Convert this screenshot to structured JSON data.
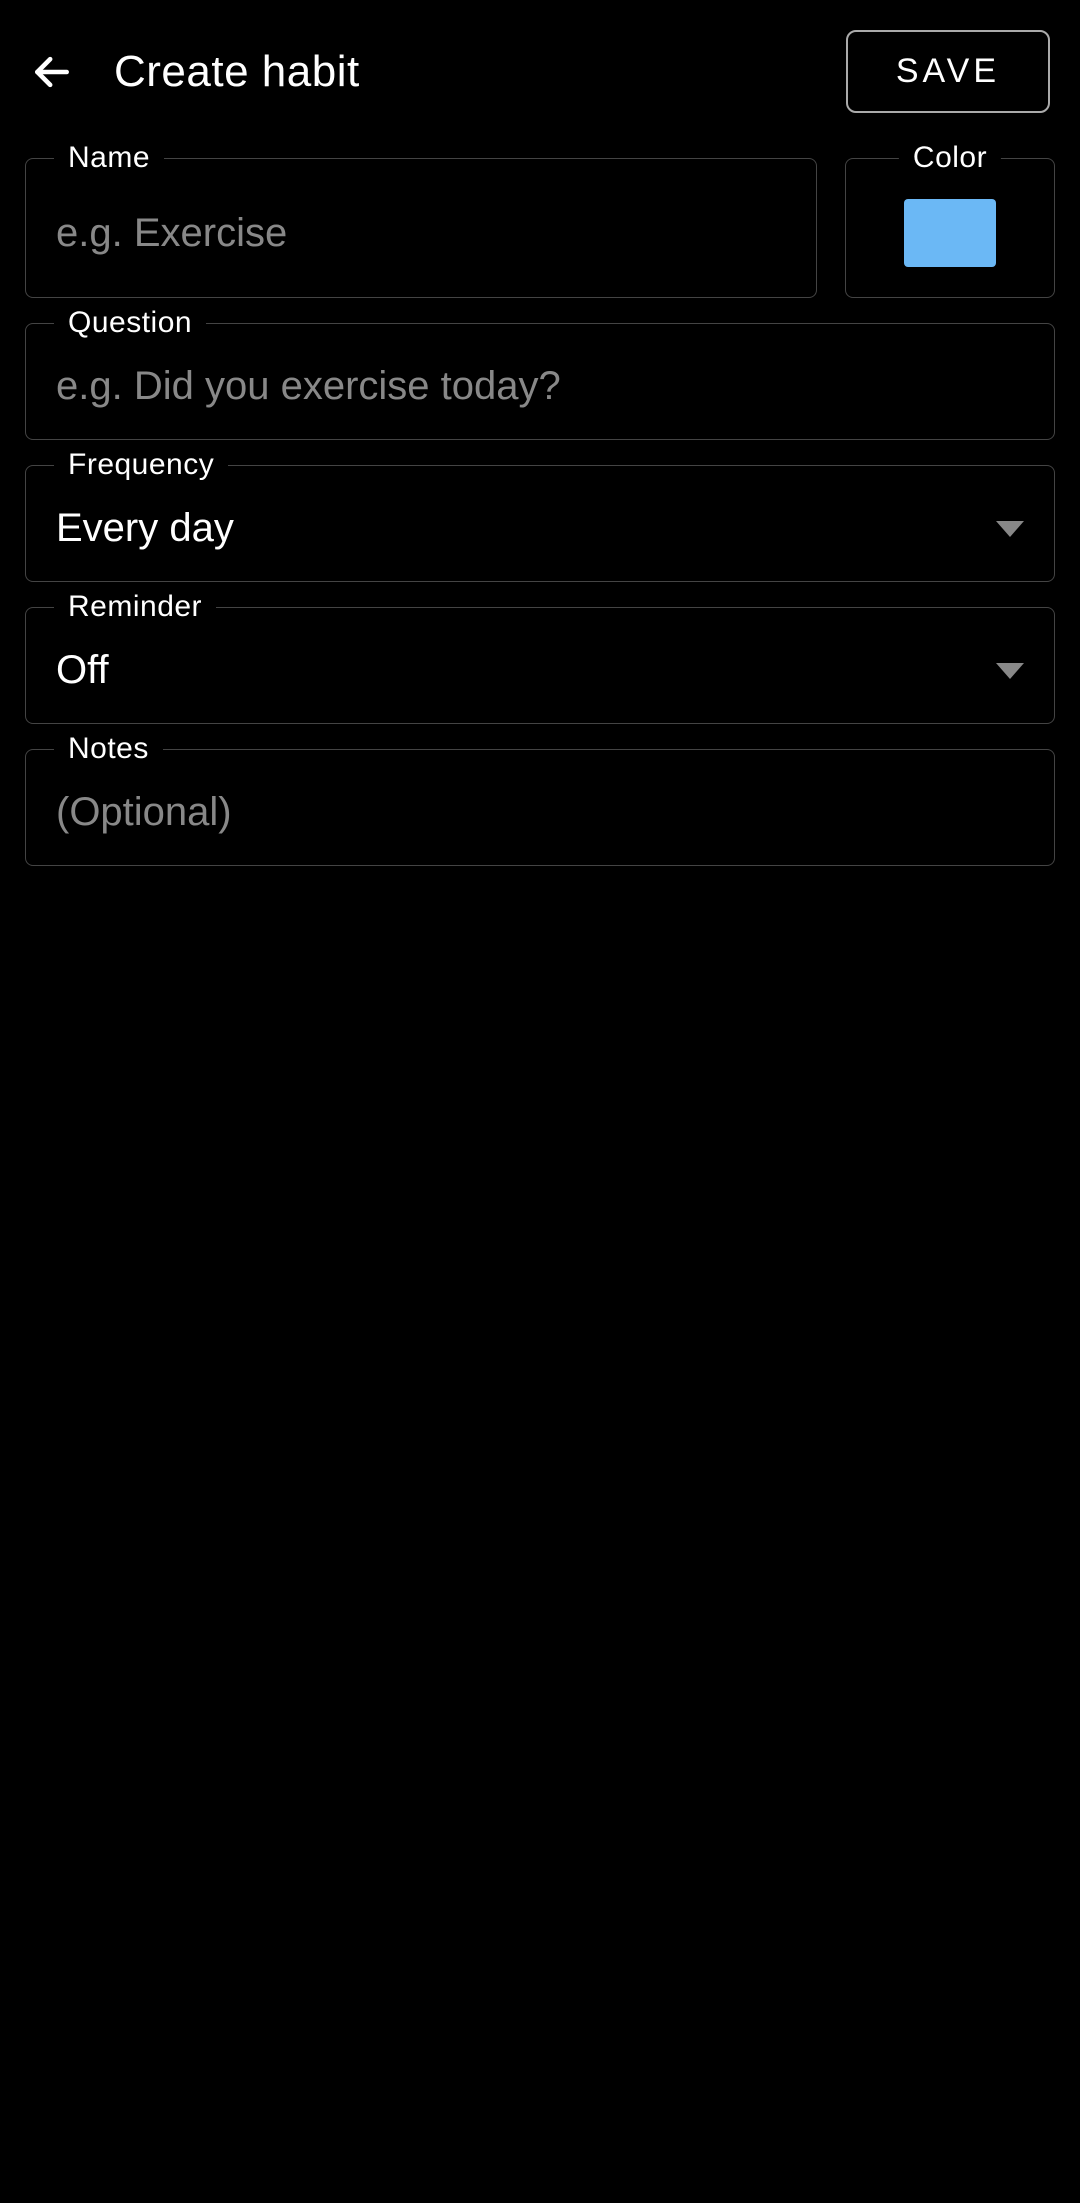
{
  "header": {
    "title": "Create habit",
    "save_label": "SAVE"
  },
  "fields": {
    "name": {
      "label": "Name",
      "placeholder": "e.g. Exercise",
      "value": ""
    },
    "color": {
      "label": "Color",
      "value": "#6BB8F5"
    },
    "question": {
      "label": "Question",
      "placeholder": "e.g. Did you exercise today?",
      "value": ""
    },
    "frequency": {
      "label": "Frequency",
      "value": "Every day"
    },
    "reminder": {
      "label": "Reminder",
      "value": "Off"
    },
    "notes": {
      "label": "Notes",
      "placeholder": "(Optional)",
      "value": ""
    }
  }
}
